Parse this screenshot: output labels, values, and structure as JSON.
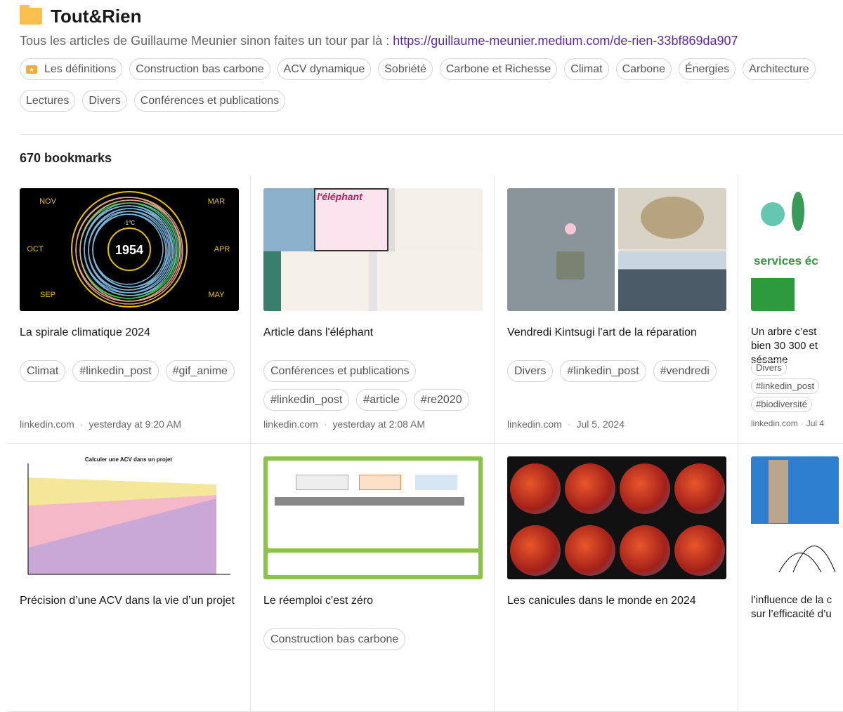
{
  "collection": {
    "title": "Tout&Rien",
    "description": "Tous les articles de Guillaume Meunier sinon faites un tour par là : ",
    "link": "https://guillaume-meunier.medium.com/de-rien-33bf869da907",
    "accent": "#fbbf4e"
  },
  "chips_row1": [
    "Les définitions",
    "Construction bas carbone",
    "ACV dynamique",
    "Sobriété",
    "Carbone et Richesse",
    "Climat",
    "Carbone",
    "Énergies",
    "Architecture"
  ],
  "chips_row2": [
    "Lectures",
    "Divers",
    "Conférences et publications"
  ],
  "count": "670 bookmarks",
  "cards": [
    {
      "title": "La spirale climatique 2024",
      "tags": [
        "Climat",
        "#linkedin_post",
        "#gif_anime"
      ],
      "domain": "linkedin.com",
      "time": "yesterday at 9:20 AM",
      "thumb": {
        "year": "1954",
        "months": [
          "NOV",
          "MAR",
          "OCT",
          "APR",
          "SEP",
          "MAY"
        ],
        "label": "-1°C"
      }
    },
    {
      "title": "Article dans l'éléphant",
      "tags": [
        "Conférences et publications",
        "#linkedin_post",
        "#article",
        "#re2020"
      ],
      "domain": "linkedin.com",
      "time": "yesterday at 2:08 AM",
      "thumb": {
        "label": "l'éléphant"
      }
    },
    {
      "title": "Vendredi Kintsugi l'art de la réparation",
      "tags": [
        "Divers",
        "#linkedin_post",
        "#vendredi"
      ],
      "domain": "linkedin.com",
      "time": "Jul 5, 2024"
    },
    {
      "title": "Un arbre c’est bien 30 300 et sésame",
      "tags": [
        "Divers",
        "#linkedin_post",
        "#biodiversité"
      ],
      "domain": "linkedin.com",
      "time": "Jul 4",
      "thumb": {
        "label": "services éc"
      }
    },
    {
      "title": "Précision d’une ACV dans la vie d’un projet",
      "tags": [],
      "domain": "",
      "time": "",
      "thumb": {
        "label": "Calculer une ACV dans un projet"
      }
    },
    {
      "title": "Le réemploi c'est zéro",
      "tags": [
        "Construction bas carbone"
      ],
      "domain": "",
      "time": ""
    },
    {
      "title": "Les canicules dans le monde en 2024",
      "tags": [],
      "domain": "",
      "time": ""
    },
    {
      "title": "l’influence de la c sur l’efficacité d’u",
      "tags": [],
      "domain": "",
      "time": ""
    }
  ]
}
